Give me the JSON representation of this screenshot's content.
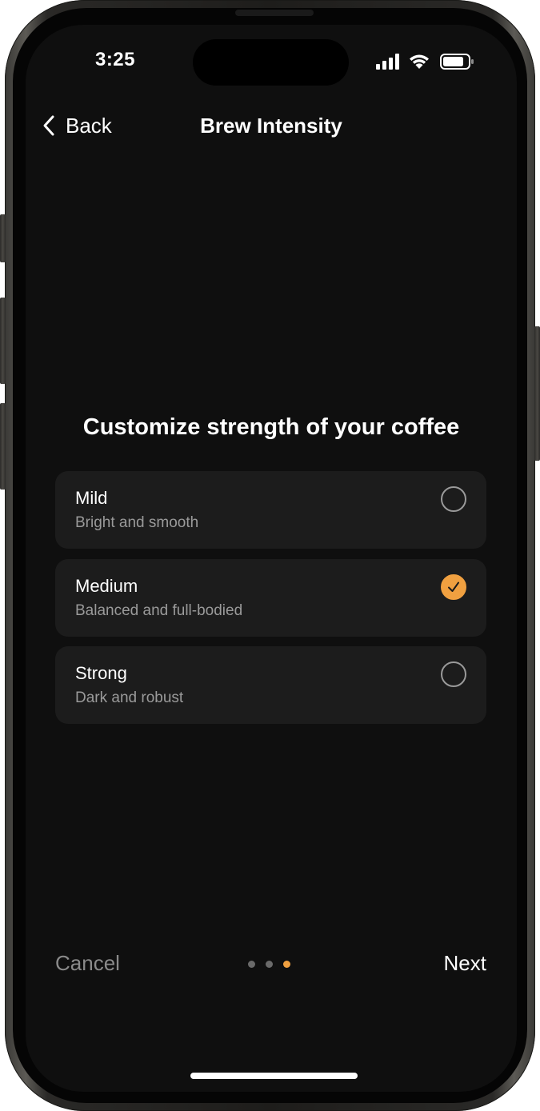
{
  "status_bar": {
    "time": "3:25",
    "signal_icon": "cellular-signal-icon",
    "wifi_icon": "wifi-icon",
    "battery_icon": "battery-icon"
  },
  "nav": {
    "back_label": "Back",
    "back_icon": "chevron-left-icon",
    "title": "Brew Intensity"
  },
  "main": {
    "heading": "Customize strength of your coffee",
    "options": [
      {
        "title": "Mild",
        "subtitle": "Bright and smooth",
        "selected": false
      },
      {
        "title": "Medium",
        "subtitle": "Balanced and full-bodied",
        "selected": true
      },
      {
        "title": "Strong",
        "subtitle": "Dark and robust",
        "selected": false
      }
    ]
  },
  "footer": {
    "cancel_label": "Cancel",
    "next_label": "Next",
    "page_dots": {
      "total": 3,
      "current": 3
    }
  },
  "colors": {
    "accent": "#f0a040",
    "background": "#0f0f0f",
    "card": "#1c1c1c",
    "secondary_text": "#9a9a9a",
    "inactive_dot": "#6a6a6a"
  }
}
